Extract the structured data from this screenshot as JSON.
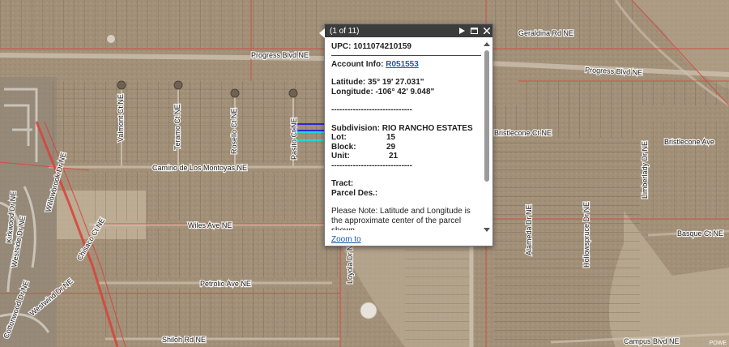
{
  "map": {
    "streets": [
      "Progress Blvd NE",
      "Progress Blvd NE",
      "Geraldina Rd NE",
      "Valmont Ct NE",
      "Teramo Ct NE",
      "Rosello Ct NE",
      "Pasito Ct NE",
      "Camino de Los Montoyas NE",
      "Wiles Ave NE",
      "Petrolio Ave NE",
      "Shiloh Rd NE",
      "Bristlecone Ave",
      "Bristlecone Ct NE",
      "Basque Ct NE",
      "Campus Blvd NE",
      "Alameda Dr NE",
      "Hollowspruce Dr NE",
      "Limberlady Dr NE",
      "Loyola Dr NE",
      "Willowbrook Dr NE",
      "Kirkwood Dr NE",
      "Westwind Dr NE",
      "Cottonwood Dr NE",
      "Westside Dr NE",
      "Chisaco Ct NE"
    ],
    "attribution": "POWE"
  },
  "popup": {
    "title": "(1 of 11)",
    "upc_label": "UPC:",
    "upc_value": "1011074210159",
    "account_label": "Account Info:",
    "account_value": "R051553",
    "latitude_label": "Latitude:",
    "latitude_value": "35° 19' 27.031\"",
    "longitude_label": "Longitude:",
    "longitude_value": "-106° 42' 9.048\"",
    "separator": "------------------------------",
    "subdivision_label": "Subdivision:",
    "subdivision_value": "RIO RANCHO ESTATES",
    "lot_label": "Lot:",
    "lot_value": "15",
    "block_label": "Block:",
    "block_value": "29",
    "unit_label": "Unit:",
    "unit_value": "21",
    "tract_label": "Tract:",
    "parcel_label": "Parcel Des.:",
    "note": "Please Note: Latitude and Longitude is the approximate center of the parcel shown.",
    "zoom_link": "Zoom to"
  },
  "colors": {
    "terrain": "#a08f78",
    "parcel_line": "#5b4f40",
    "boundary_red": "#d8453c",
    "selected_parcel": "#2a2ad8",
    "highlight_parcel": "#29d4d4",
    "popup_header": "#3c3c3c",
    "link": "#1b5aa8"
  }
}
